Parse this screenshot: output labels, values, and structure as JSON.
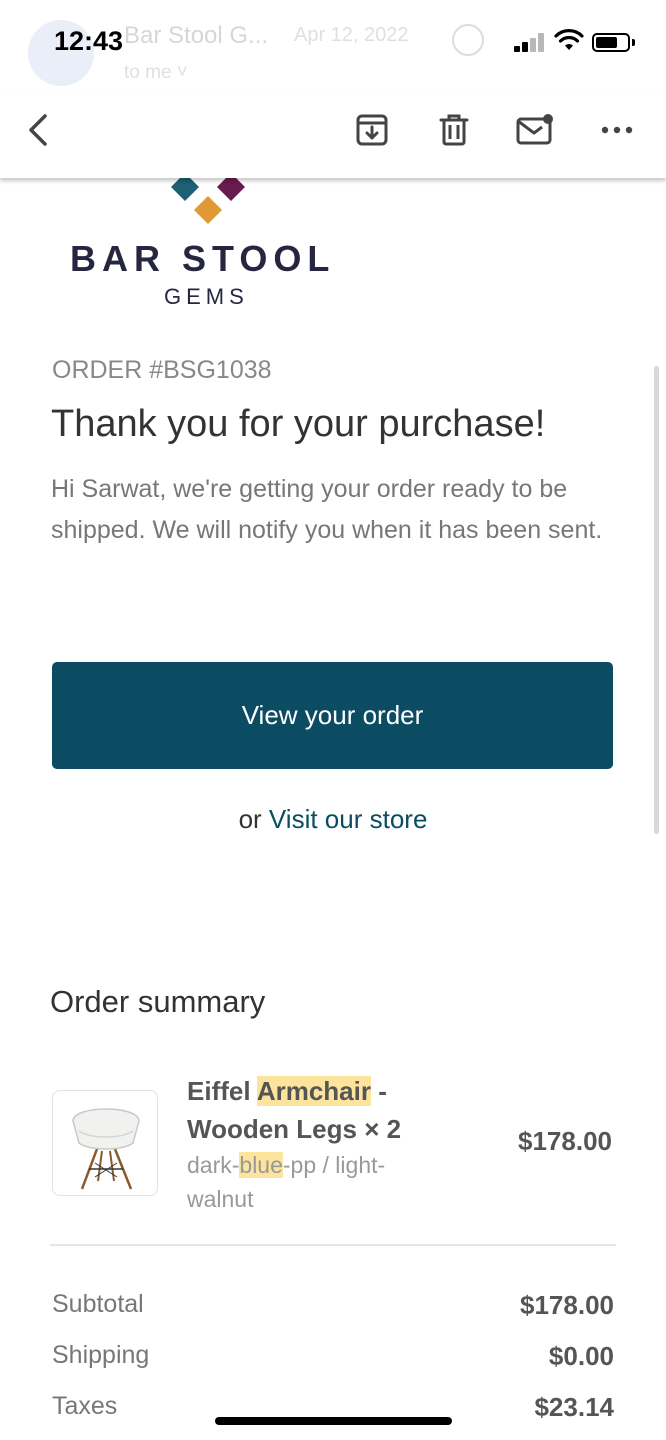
{
  "status_bar": {
    "time": "12:43"
  },
  "background_header": {
    "sender": "Bar Stool G...",
    "date": "Apr 12, 2022",
    "to": "to me ˅"
  },
  "toolbar": {
    "back_icon": "chevron-left-icon",
    "archive_icon": "archive-icon",
    "delete_icon": "trash-icon",
    "mark_unread_icon": "mail-unread-icon",
    "more_icon": "more-horizontal-icon"
  },
  "email": {
    "brand": {
      "name": "BAR STOOL",
      "sub": "GEMS",
      "colors": [
        "#2b2b4a",
        "#1d5f74",
        "#6a1b4d",
        "#e09a35"
      ]
    },
    "order_number": "ORDER #BSG1038",
    "headline": "Thank you for your purchase!",
    "intro": "Hi Sarwat, we're getting your order ready to be shipped. We will notify you when it has been sent.",
    "cta_label": "View your order",
    "or_text": "or ",
    "store_link": "Visit our store",
    "summary_heading": "Order summary",
    "item": {
      "title_pre": "Eiffel ",
      "title_highlight": "Armchair",
      "title_post": " - Wooden Legs × 2",
      "variant_pre": "dark-",
      "variant_highlight": "blue",
      "variant_post": "-pp / light-walnut",
      "price": "$178.00"
    },
    "totals": [
      {
        "label": "Subtotal",
        "value": "$178.00"
      },
      {
        "label": "Shipping",
        "value": "$0.00"
      },
      {
        "label": "Taxes",
        "value": "$23.14"
      }
    ]
  },
  "theme": {
    "accent": "#0c4c63",
    "highlight": "#fde49d"
  }
}
